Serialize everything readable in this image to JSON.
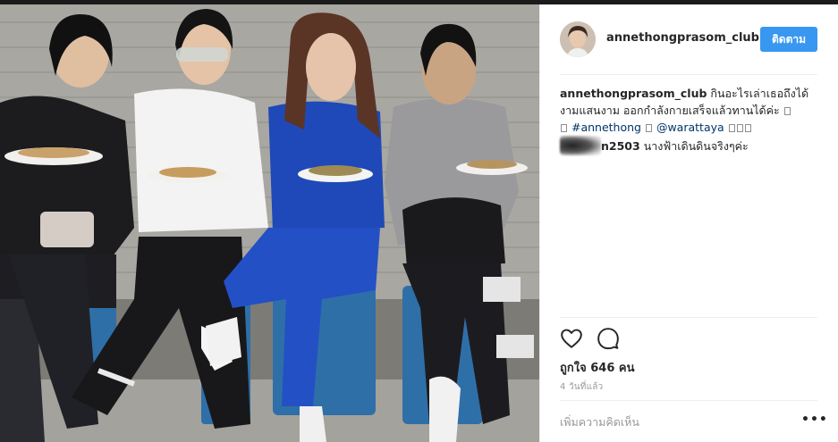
{
  "post": {
    "username": "annethongprasom_club",
    "follow_label": "ติดตาม",
    "caption_user": "annethongprasom_club",
    "caption_text_1": "กินอะไรเล่าเธอถึงได้",
    "caption_text_2": "งามแสนงาม ออกกำลังกายเสร็จแล้วทานได้ค่ะ",
    "hashtag": "#annethong",
    "mention": "@warattaya",
    "comment_user_suffix": "n2503",
    "comment_text": "นางฟ้าเดินดินจริงๆค่ะ",
    "likes_label": "ถูกใจ 646 คน",
    "time_ago": "4 วันที่แล้ว",
    "add_comment_placeholder": "เพิ่มความคิดเห็น",
    "more_label": "•••"
  },
  "icons": {
    "like": "heart-icon",
    "comment": "comment-bubble-icon",
    "more": "more-options-icon"
  },
  "colors": {
    "follow_button": "#3897f0",
    "link": "#003569",
    "muted": "#999999"
  }
}
